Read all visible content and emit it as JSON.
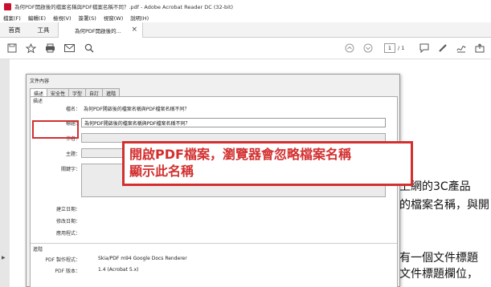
{
  "window": {
    "title": "為何PDF開啟後的檔案名稱與PDF檔案名稱不同？.pdf - Adobe Acrobat Reader DC (32-bit)"
  },
  "menu": [
    "檔案(F)",
    "編輯(E)",
    "檢視(V)",
    "簽署(S)",
    "視窗(W)",
    "說明(H)"
  ],
  "tabs": {
    "home": "首頁",
    "tools": "工具",
    "document": "為何PDF開啟後的..."
  },
  "toolbar": {
    "page_current": "1",
    "page_total": "/ 1"
  },
  "dialog": {
    "title": "文件內容",
    "tabs": [
      "描述",
      "安全性",
      "字型",
      "自訂",
      "進階"
    ],
    "description_section": "描述",
    "fields": {
      "filename_label": "檔名：",
      "filename_value": "為何PDF開啟後的檔案名稱與PDF檔案名稱不同？",
      "title_label": "標題：",
      "title_value": "為何PDF開啟後的檔案名稱與PDF檔案名稱不同？",
      "author_label": "作者：",
      "subject_label": "主題：",
      "keywords_label": "關鍵字：",
      "created_label": "建立日期：",
      "modified_label": "修改日期：",
      "app_label": "應用程式："
    },
    "advanced_section": "進階",
    "producer_label": "PDF 製作程式：",
    "producer_value": "Skia/PDF m94 Google Docs Renderer",
    "version_label": "PDF 版本：",
    "version_value": "1.4 (Acrobat 5.x)"
  },
  "annotation": {
    "line1": "開啟PDF檔案，瀏覽器會忽略檔案名稱",
    "line2": "顯示此名稱"
  },
  "document_text": {
    "line1": "上網的3C產品",
    "line2": "的檔案名稱，與開",
    "line3": "有一個文件標題",
    "line4": "文件標題欄位，"
  }
}
